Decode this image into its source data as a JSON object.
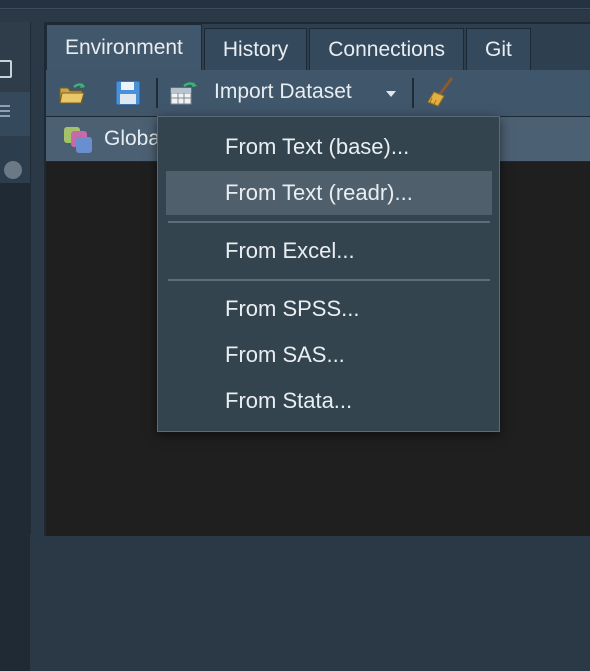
{
  "tabs": [
    "Environment",
    "History",
    "Connections",
    "Git"
  ],
  "active_tab": "Environment",
  "toolbar": {
    "import_label": "Import Dataset",
    "icons": [
      "open-folder-icon",
      "save-icon",
      "table-import-icon",
      "dropdown-caret-icon",
      "broom-icon"
    ]
  },
  "environment": {
    "selector_label": "Global"
  },
  "import_menu": {
    "items": [
      {
        "label": "From Text (base)...",
        "highlighted": false
      },
      {
        "label": "From Text (readr)...",
        "highlighted": true
      },
      {
        "label": "From Excel...",
        "highlighted": false
      },
      {
        "label": "From SPSS...",
        "highlighted": false
      },
      {
        "label": "From SAS...",
        "highlighted": false
      },
      {
        "label": "From Stata...",
        "highlighted": false
      }
    ]
  },
  "colors": {
    "pane_bg": "#34495c",
    "toolbar_bg": "#40566a",
    "menu_bg": "#34444f",
    "menu_highlight": "#4f5f6b",
    "text": "#e8edf1",
    "content_bg": "#1f1f1f"
  }
}
